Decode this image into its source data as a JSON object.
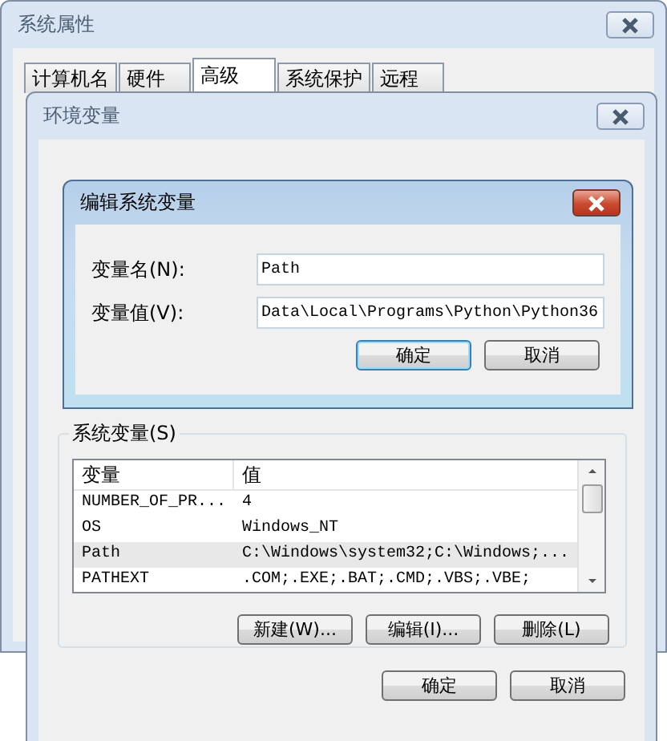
{
  "system_properties": {
    "title": "系统属性",
    "tabs": [
      {
        "label": "计算机名",
        "selected": false
      },
      {
        "label": "硬件",
        "selected": false
      },
      {
        "label": "高级",
        "selected": true
      },
      {
        "label": "系统保护",
        "selected": false
      },
      {
        "label": "远程",
        "selected": false
      }
    ]
  },
  "environment_variables": {
    "title": "环境变量",
    "system_section": {
      "label": "系统变量(S)",
      "columns": [
        "变量",
        "值"
      ],
      "rows": [
        {
          "name": "NUMBER_OF_PR...",
          "value": "4",
          "selected": false
        },
        {
          "name": "OS",
          "value": "Windows_NT",
          "selected": false
        },
        {
          "name": "Path",
          "value": "C:\\Windows\\system32;C:\\Windows;...",
          "selected": true
        },
        {
          "name": "PATHEXT",
          "value": ".COM;.EXE;.BAT;.CMD;.VBS;.VBE;",
          "selected": false
        }
      ],
      "buttons": [
        "新建(W)...",
        "编辑(I)...",
        "删除(L)"
      ]
    },
    "buttons": [
      "确定",
      "取消"
    ]
  },
  "edit_dialog": {
    "title": "编辑系统变量",
    "fields": [
      {
        "label": "变量名(N):",
        "value": "Path"
      },
      {
        "label": "变量值(V):",
        "value": "Data\\Local\\Programs\\Python\\Python36"
      }
    ],
    "buttons": [
      {
        "label": "确定",
        "focused": true
      },
      {
        "label": "取消",
        "focused": false
      }
    ]
  }
}
